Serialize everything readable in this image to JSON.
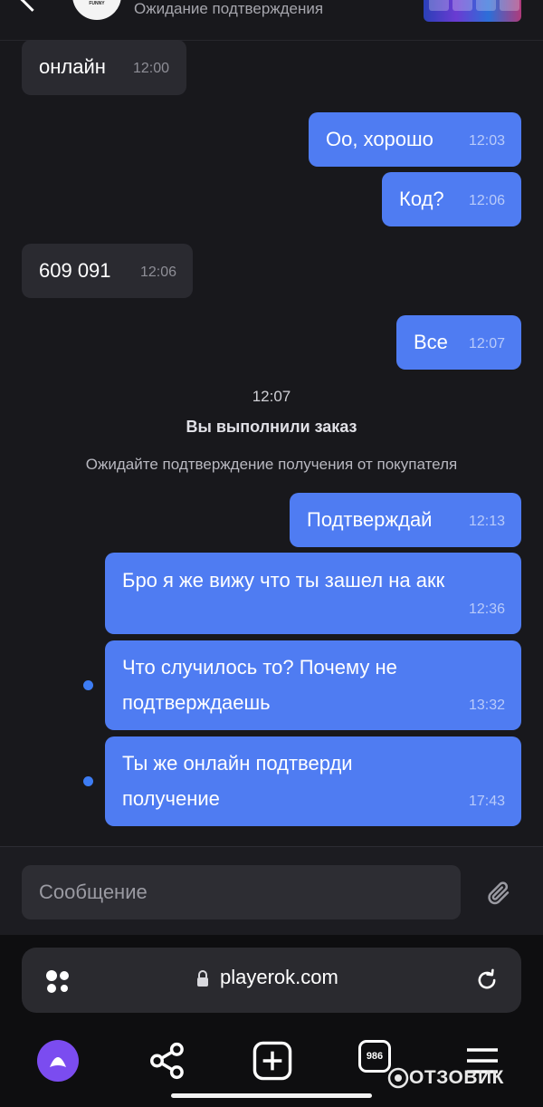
{
  "header": {
    "status": "Ожидание подтверждения",
    "avatar_text": "FUNNY"
  },
  "messages": [
    {
      "dir": "in",
      "text": "онлайн",
      "time": "12:00"
    },
    {
      "dir": "out",
      "text": "Оо, хорошо",
      "time": "12:03"
    },
    {
      "dir": "out",
      "text": "Код?",
      "time": "12:06"
    },
    {
      "dir": "in",
      "text": "609 091",
      "time": "12:06"
    },
    {
      "dir": "out",
      "text": "Все",
      "time": "12:07"
    },
    {
      "dir": "out",
      "text": "Подтверждай",
      "time": "12:13"
    },
    {
      "dir": "out",
      "text": "Бро я же вижу что ты зашел на акк",
      "time": "12:36"
    },
    {
      "dir": "out",
      "text": "Что случилось то? Почему не подтверждаешь",
      "line1": "Что случилось то? Почему не",
      "line2": "подтверждаешь",
      "time": "13:32",
      "unread_dot": true
    },
    {
      "dir": "out",
      "text": "Ты же онлайн подтверди получение",
      "line1": "Ты же онлайн подтверди",
      "line2": "получение",
      "time": "17:43",
      "unread_dot": true
    }
  ],
  "system_event": {
    "time": "12:07",
    "title": "Вы выполнили заказ",
    "subtitle": "Ожидайте подтверждение получения от покупателя"
  },
  "composer": {
    "placeholder": "Сообщение",
    "attach_icon": "paperclip-icon"
  },
  "browser": {
    "url": "playerok.com",
    "tabs_count": "986",
    "icons": [
      "alice-icon",
      "share-icon",
      "new-tab-icon",
      "tabs-icon",
      "menu-icon"
    ]
  },
  "watermark": "ОТЗОВИК",
  "colors": {
    "background": "#18181c",
    "outgoing_bubble": "#4f7cf2",
    "incoming_bubble": "#2a2a30",
    "unread_dot": "#3d7cf4",
    "alice": "#7b4cf0"
  }
}
